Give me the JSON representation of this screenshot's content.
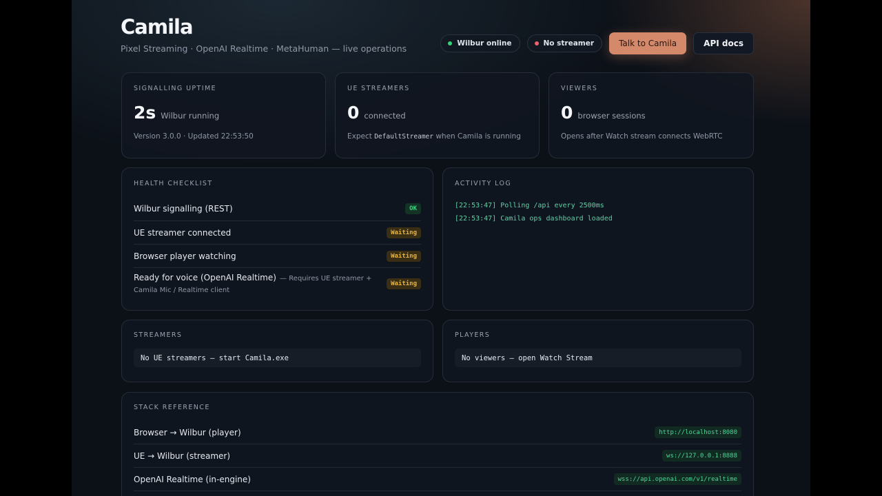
{
  "header": {
    "title": "Camila",
    "subtitle": "Pixel Streaming · OpenAI Realtime · MetaHuman — live operations",
    "status_wilbur": "Wilbur online",
    "status_streamer": "No streamer",
    "talk_button": "Talk to Camila",
    "api_button": "API docs"
  },
  "stats": {
    "uptime": {
      "label": "SIGNALLING UPTIME",
      "value": "2s",
      "unit": "Wilbur running",
      "desc": "Version 3.0.0 · Updated 22:53:50"
    },
    "streamers": {
      "label": "UE STREAMERS",
      "value": "0",
      "unit": "connected",
      "desc_pre": "Expect ",
      "desc_code": "DefaultStreamer",
      "desc_post": " when Camila is running"
    },
    "viewers": {
      "label": "VIEWERS",
      "value": "0",
      "unit": "browser sessions",
      "desc": "Opens after Watch stream connects WebRTC"
    }
  },
  "health": {
    "label": "HEALTH CHECKLIST",
    "items": [
      {
        "text": "Wilbur signalling (REST)",
        "status": "OK"
      },
      {
        "text": "UE streamer connected",
        "status": "Waiting"
      },
      {
        "text": "Browser player watching",
        "status": "Waiting"
      },
      {
        "text": "Ready for voice (OpenAI Realtime)",
        "note": "— Requires UE streamer + Camila Mic / Realtime client",
        "status": "Waiting"
      }
    ]
  },
  "activity": {
    "label": "ACTIVITY LOG",
    "lines": [
      "[22:53:47] Polling /api every 2500ms",
      "[22:53:47] Camila ops dashboard loaded"
    ]
  },
  "streamers_panel": {
    "label": "STREAMERS",
    "empty": "No UE streamers — start Camila.exe"
  },
  "players_panel": {
    "label": "PLAYERS",
    "empty": "No viewers — open Watch Stream"
  },
  "stack": {
    "label": "STACK REFERENCE",
    "rows": [
      {
        "name": "Browser → Wilbur (player)",
        "url": "http://localhost:8080"
      },
      {
        "name": "UE → Wilbur (streamer)",
        "url": "ws://127.0.0.1:8888"
      },
      {
        "name": "OpenAI Realtime (in-engine)",
        "url": "wss://api.openai.com/v1/realtime"
      }
    ]
  },
  "colors": {
    "accent": "#d4896a",
    "online": "#34d27a",
    "offline": "#f0606b",
    "ok": "#3fd687",
    "waiting": "#e8b33c",
    "log": "#5fd1a6"
  }
}
